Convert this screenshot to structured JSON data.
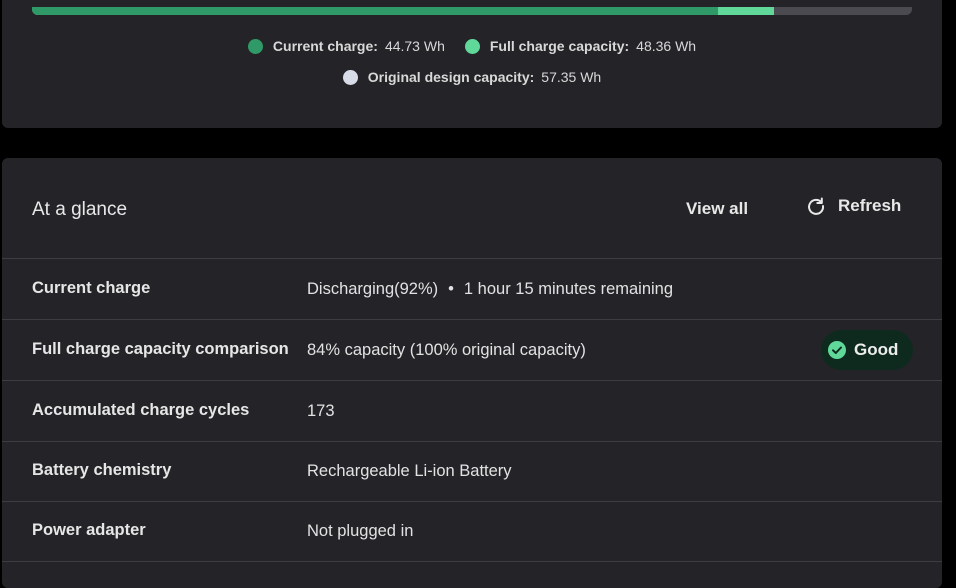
{
  "capacity_card": {
    "progress": {
      "current_fraction": 0.78,
      "full_fraction": 0.843,
      "colors": {
        "current": "#2f9a68",
        "full": "#5fd89a",
        "track": "#4a4a50"
      }
    },
    "legend": [
      {
        "label": "Current charge:",
        "value": "44.73 Wh",
        "color": "#2f9a68"
      },
      {
        "label": "Full charge capacity:",
        "value": "48.36 Wh",
        "color": "#5fd89a"
      },
      {
        "label": "Original design capacity:",
        "value": "57.35 Wh",
        "color": "#d8dce8"
      }
    ]
  },
  "glance": {
    "title": "At a glance",
    "view_all": "View all",
    "refresh": "Refresh",
    "refresh_icon": "refresh-icon",
    "rows": [
      {
        "label": "Current charge",
        "value": "Discharging(92%)",
        "value_sep": "•",
        "value_extra": "1 hour 15 minutes remaining"
      },
      {
        "label": "Full charge capacity comparison",
        "value": "84% capacity (100% original capacity)",
        "badge": "Good",
        "badge_icon": "check-circle-icon",
        "badge_color": "#5fd89a"
      },
      {
        "label": "Accumulated charge cycles",
        "value": "173"
      },
      {
        "label": "Battery chemistry",
        "value": "Rechargeable Li-ion Battery"
      },
      {
        "label": "Power adapter",
        "value": "Not plugged in"
      }
    ]
  }
}
